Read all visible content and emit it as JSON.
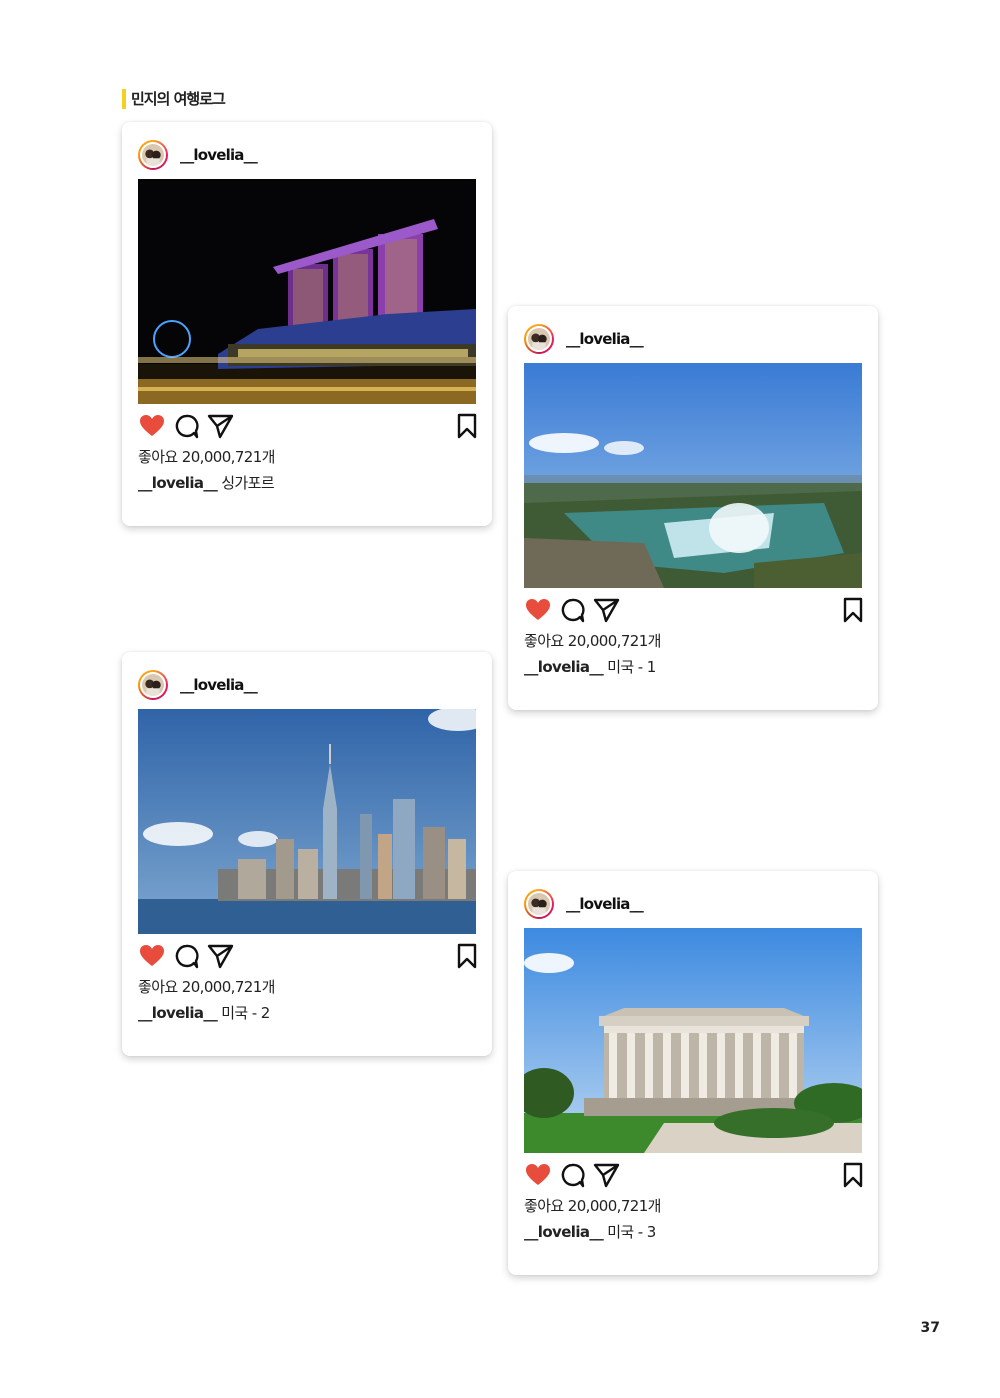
{
  "section_title": "민지의 여행로그",
  "page_number": "37",
  "colors": {
    "accent_bar": "#f5d020",
    "heart": "#e74c3c"
  },
  "icons": [
    "heart-icon",
    "comment-icon",
    "share-icon",
    "bookmark-icon"
  ],
  "posts": [
    {
      "username": "__lovelia__",
      "likes": "좋아요 20,000,721개",
      "caption_user": "__lovelia__",
      "caption_text": "싱가포르",
      "photo": "marina-bay-sands-night"
    },
    {
      "username": "__lovelia__",
      "likes": "좋아요 20,000,721개",
      "caption_user": "__lovelia__",
      "caption_text": "미국 - 1",
      "photo": "niagara-falls"
    },
    {
      "username": "__lovelia__",
      "likes": "좋아요 20,000,721개",
      "caption_user": "__lovelia__",
      "caption_text": "미국 - 2",
      "photo": "new-york-skyline"
    },
    {
      "username": "__lovelia__",
      "likes": "좋아요 20,000,721개",
      "caption_user": "__lovelia__",
      "caption_text": "미국 - 3",
      "photo": "lincoln-memorial"
    }
  ]
}
